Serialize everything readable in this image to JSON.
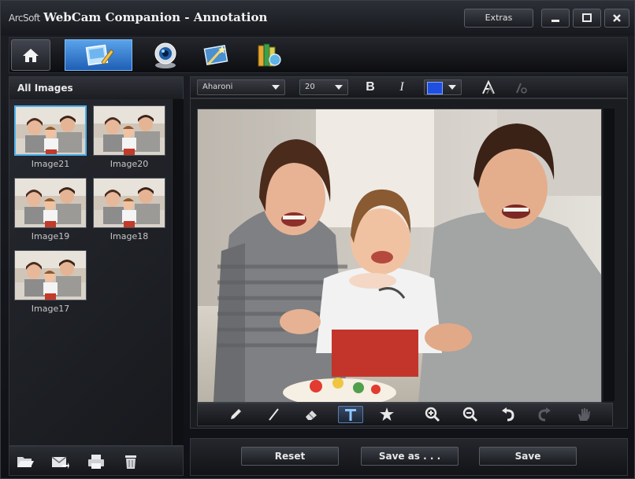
{
  "window": {
    "brand": "ArcSoft",
    "app_title": "WebCam Companion",
    "separator": " - ",
    "mode_title": "Annotation",
    "extras_label": "Extras"
  },
  "modes": [
    {
      "icon": "home-icon"
    },
    {
      "icon": "annotation-icon",
      "active": true
    },
    {
      "icon": "webcam-icon"
    },
    {
      "icon": "magic-wand-icon"
    },
    {
      "icon": "books-icon"
    }
  ],
  "gallery": {
    "header": "All Images",
    "images": [
      {
        "caption": "Image21",
        "selected": true
      },
      {
        "caption": "Image20"
      },
      {
        "caption": "Image19"
      },
      {
        "caption": "Image18"
      },
      {
        "caption": "Image17"
      }
    ]
  },
  "format": {
    "font": "Aharoni",
    "size": "20",
    "bold_label": "B",
    "italic_label": "I",
    "color": "#1e4fe0"
  },
  "tools": [
    "pencil-icon",
    "line-icon",
    "eraser-icon",
    "text-icon",
    "stamp-icon",
    "zoom-in-icon",
    "zoom-out-icon",
    "undo-icon",
    "redo-icon",
    "hand-icon"
  ],
  "actions": {
    "reset": "Reset",
    "save_as": "Save as . . .",
    "save": "Save"
  },
  "colors": {
    "accent": "#2f7fd6",
    "selection": "#4fb0ea"
  }
}
